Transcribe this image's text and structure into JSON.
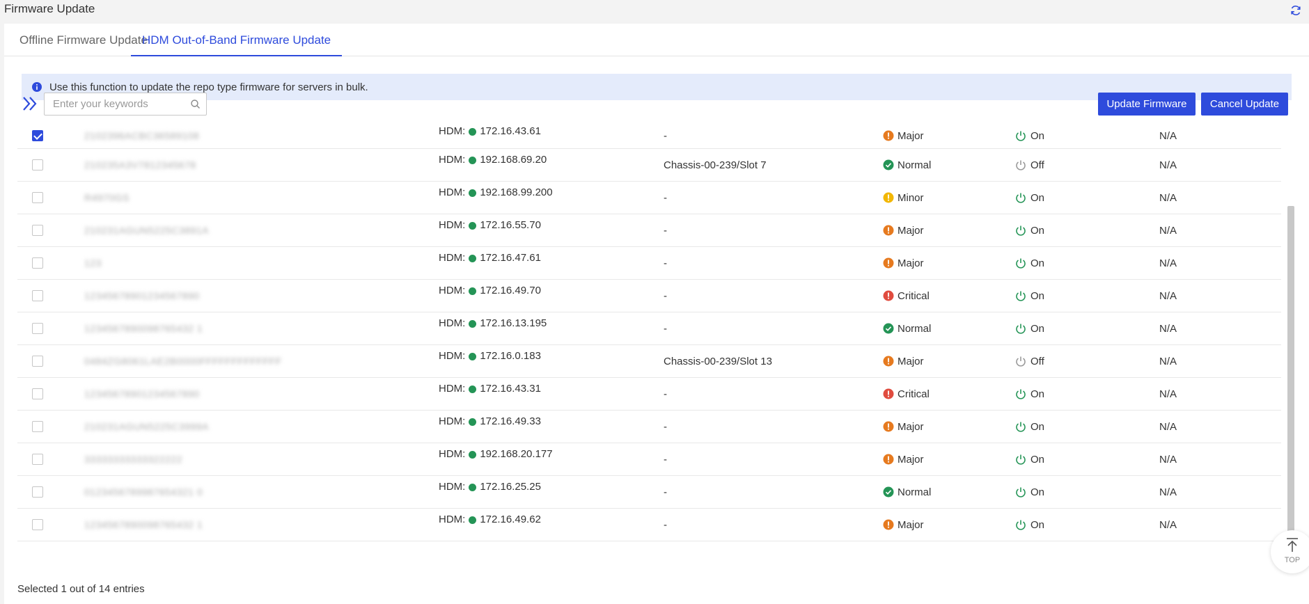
{
  "header": {
    "title": "Firmware Update"
  },
  "tabs": [
    {
      "label": "Offline Firmware Update",
      "active": false
    },
    {
      "label": "HDM Out-of-Band Firmware Update",
      "active": true
    }
  ],
  "info": {
    "text": "Use this function to update the repo type firmware for servers in bulk."
  },
  "toolbar": {
    "search_placeholder": "Enter your keywords",
    "update_label": "Update Firmware",
    "cancel_label": "Cancel Update"
  },
  "rows": [
    {
      "checked": true,
      "name": "2102396ACBC36589108",
      "ip_prefix": "HDM:",
      "ip": "172.16.43.61",
      "location": "-",
      "health": "Major",
      "power": "On"
    },
    {
      "checked": false,
      "name": "210235A3V7812345678",
      "ip_prefix": "HDM:",
      "ip": "192.168.69.20",
      "location": "Chassis-00-239/Slot 7",
      "health": "Normal",
      "power": "Off"
    },
    {
      "checked": false,
      "name": "R4970GS",
      "ip_prefix": "HDM:",
      "ip": "192.168.99.200",
      "location": "-",
      "health": "Minor",
      "power": "On"
    },
    {
      "checked": false,
      "name": "210231AGUN5225C3891A",
      "ip_prefix": "HDM:",
      "ip": "172.16.55.70",
      "location": "-",
      "health": "Major",
      "power": "On"
    },
    {
      "checked": false,
      "name": "123",
      "ip_prefix": "HDM:",
      "ip": "172.16.47.61",
      "location": "-",
      "health": "Major",
      "power": "On"
    },
    {
      "checked": false,
      "name": "12345678901234567890",
      "ip_prefix": "HDM:",
      "ip": "172.16.49.70",
      "location": "-",
      "health": "Critical",
      "power": "On"
    },
    {
      "checked": false,
      "name": "1234567890098765432 1",
      "ip_prefix": "HDM:",
      "ip": "172.16.13.195",
      "location": "-",
      "health": "Normal",
      "power": "On"
    },
    {
      "checked": false,
      "name": "0484ZG8061LAE2B0000FFFFFFFFFFFFF",
      "ip_prefix": "HDM:",
      "ip": "172.16.0.183",
      "location": "Chassis-00-239/Slot 13",
      "health": "Major",
      "power": "Off"
    },
    {
      "checked": false,
      "name": "12345678901234567890",
      "ip_prefix": "HDM:",
      "ip": "172.16.43.31",
      "location": "-",
      "health": "Critical",
      "power": "On"
    },
    {
      "checked": false,
      "name": "210231AGUN5225C3999A",
      "ip_prefix": "HDM:",
      "ip": "172.16.49.33",
      "location": "-",
      "health": "Major",
      "power": "On"
    },
    {
      "checked": false,
      "name": "33333333333322222",
      "ip_prefix": "HDM:",
      "ip": "192.168.20.177",
      "location": "-",
      "health": "Major",
      "power": "On"
    },
    {
      "checked": false,
      "name": "0123456789987654321 0",
      "ip_prefix": "HDM:",
      "ip": "172.16.25.25",
      "location": "-",
      "health": "Normal",
      "power": "On"
    },
    {
      "checked": false,
      "name": "1234567890098765432 1",
      "ip_prefix": "HDM:",
      "ip": "172.16.49.62",
      "location": "-",
      "health": "Major",
      "power": "On"
    }
  ],
  "na_text": "N/A",
  "health_colors": {
    "Major": "#e67a1f",
    "Normal": "#249456",
    "Minor": "#f2b705",
    "Critical": "#e04c3f"
  },
  "power_colors": {
    "On": "#249456",
    "Off": "#999999"
  },
  "footer": {
    "text": "Selected 1 out of 14 entries"
  },
  "totop_label": "TOP",
  "accent": "#2e4bdc"
}
